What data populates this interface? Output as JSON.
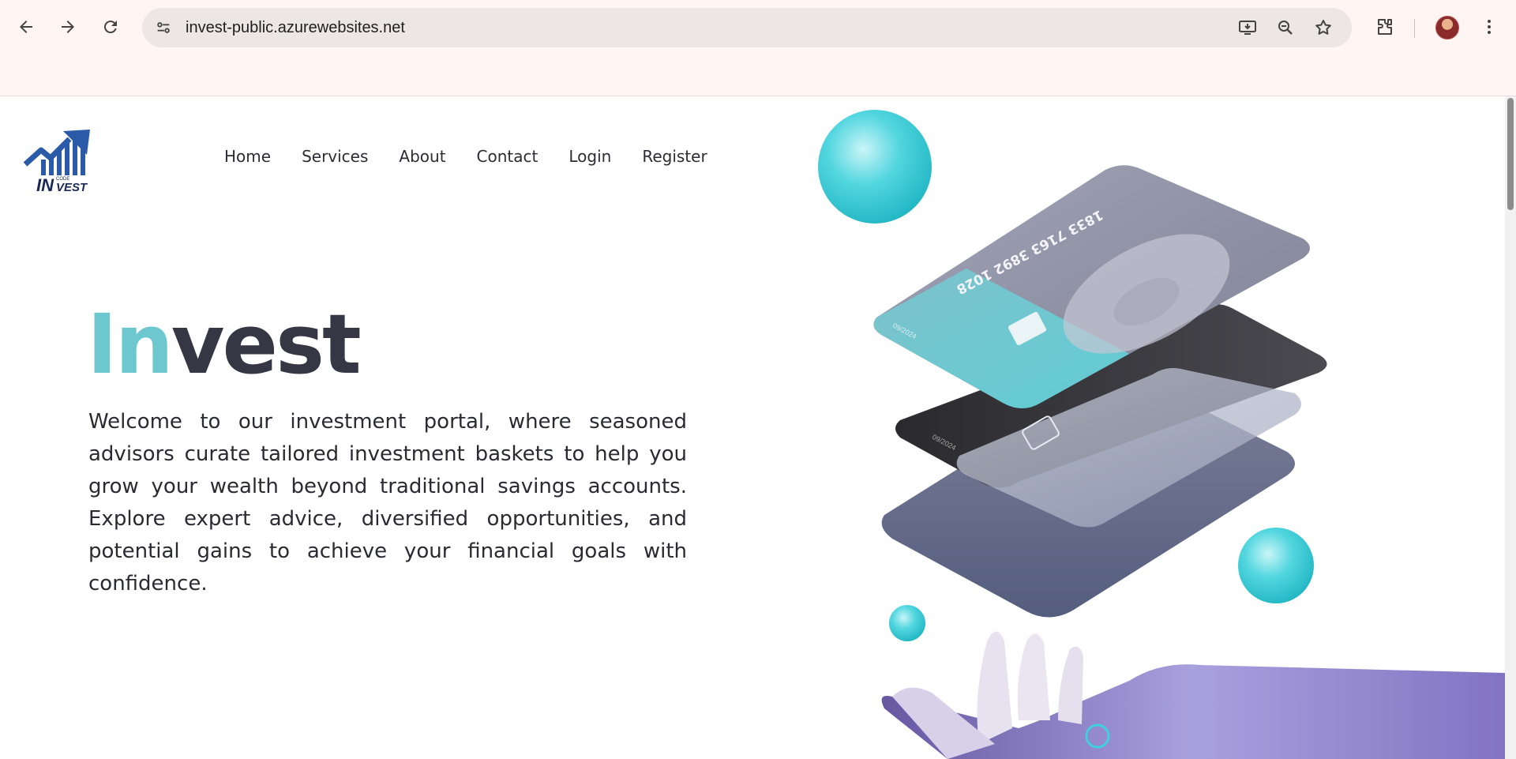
{
  "browser": {
    "url": "invest-public.azurewebsites.net",
    "icons": [
      "back-icon",
      "forward-icon",
      "reload-icon",
      "site-info-icon",
      "install-icon",
      "zoom-icon",
      "bookmark-star-icon",
      "extensions-icon",
      "profile-avatar",
      "menu-icon"
    ]
  },
  "site": {
    "logo_text_main": "IN",
    "logo_text_small": "CODE",
    "logo_text_tail": "VEST",
    "nav": [
      {
        "label": "Home"
      },
      {
        "label": "Services"
      },
      {
        "label": "About"
      },
      {
        "label": "Contact"
      },
      {
        "label": "Login"
      },
      {
        "label": "Register"
      }
    ],
    "hero": {
      "title_accent": "In",
      "title_rest": "vest",
      "text": "Welcome to our investment portal, where seasoned advisors curate tailored investment baskets to help you grow your wealth beyond traditional savings accounts. Explore expert advice, diversified opportunities, and potential gains to achieve your financial goals with confidence."
    },
    "card": {
      "number": "1833 7163 3892 1028",
      "expiry": "09/2024"
    },
    "colors": {
      "accent": "#6cc7cf",
      "heading": "#363644",
      "orb": "#3fd0dc"
    }
  }
}
